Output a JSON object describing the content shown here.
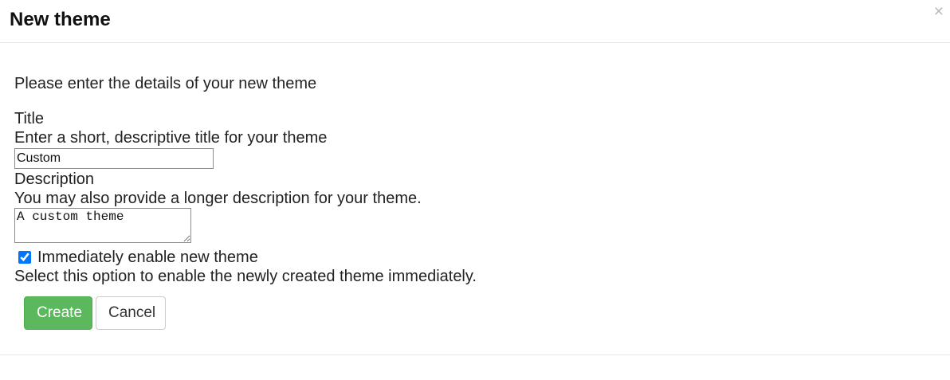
{
  "dialog": {
    "title": "New theme",
    "close_glyph": "×",
    "close_icon": "close-icon"
  },
  "form": {
    "intro": "Please enter the details of your new theme",
    "title": {
      "label": "Title",
      "help": "Enter a short, descriptive title for your theme",
      "value": "Custom"
    },
    "description": {
      "label": "Description",
      "help": "You may also provide a longer description for your theme.",
      "value": "A custom theme"
    },
    "enable": {
      "label": "Immediately enable new theme",
      "help": "Select this option to enable the newly created theme immediately.",
      "checked": true
    }
  },
  "buttons": {
    "create_label": "Create",
    "cancel_label": "Cancel"
  },
  "colors": {
    "primary_button": "#5cb85c",
    "divider": "#e5e5e5"
  }
}
